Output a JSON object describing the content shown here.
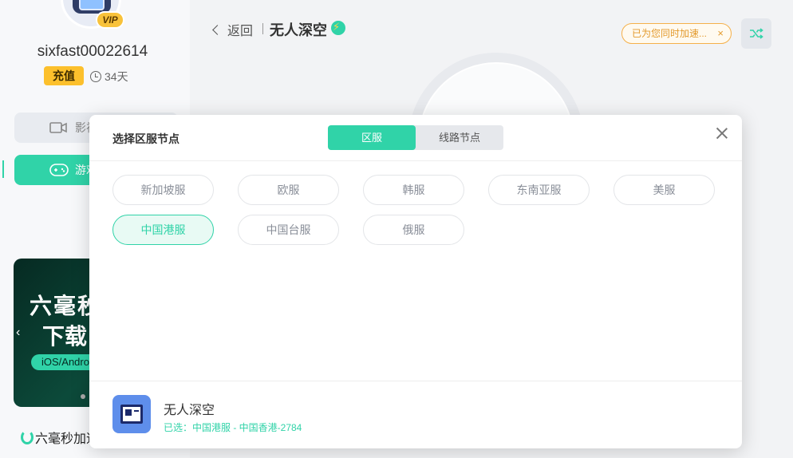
{
  "colors": {
    "accent": "#30d3a8",
    "recharge": "#fcc02c",
    "notice": "#e39a2c"
  },
  "user": {
    "vip_badge": "VIP",
    "username": "sixfast00022614",
    "recharge_label": "充值",
    "days_left": "34天"
  },
  "sidebar": {
    "items": [
      {
        "label": "影视",
        "icon": "video-icon"
      },
      {
        "label": "游戏",
        "icon": "gamepad-icon"
      }
    ],
    "banner": {
      "line1": "六毫秒",
      "line2": "下载",
      "pill": "iOS/Android"
    },
    "brand": "六毫秒加速器"
  },
  "header": {
    "back_label": "返回",
    "game_title": "无人深空",
    "notice_text": "已为您同时加速...",
    "notice_close": "×"
  },
  "modal": {
    "title": "选择区服节点",
    "tabs": [
      {
        "label": "区服",
        "active": true
      },
      {
        "label": "线路节点",
        "active": false
      }
    ],
    "regions": [
      {
        "label": "新加坡服",
        "selected": false
      },
      {
        "label": "欧服",
        "selected": false
      },
      {
        "label": "韩服",
        "selected": false
      },
      {
        "label": "东南亚服",
        "selected": false
      },
      {
        "label": "美服",
        "selected": false
      },
      {
        "label": "中国港服",
        "selected": true
      },
      {
        "label": "中国台服",
        "selected": false
      },
      {
        "label": "俄服",
        "selected": false
      }
    ],
    "footer": {
      "game_name": "无人深空",
      "selected_text": "已选：中国港服 - 中国香港-2784"
    }
  }
}
